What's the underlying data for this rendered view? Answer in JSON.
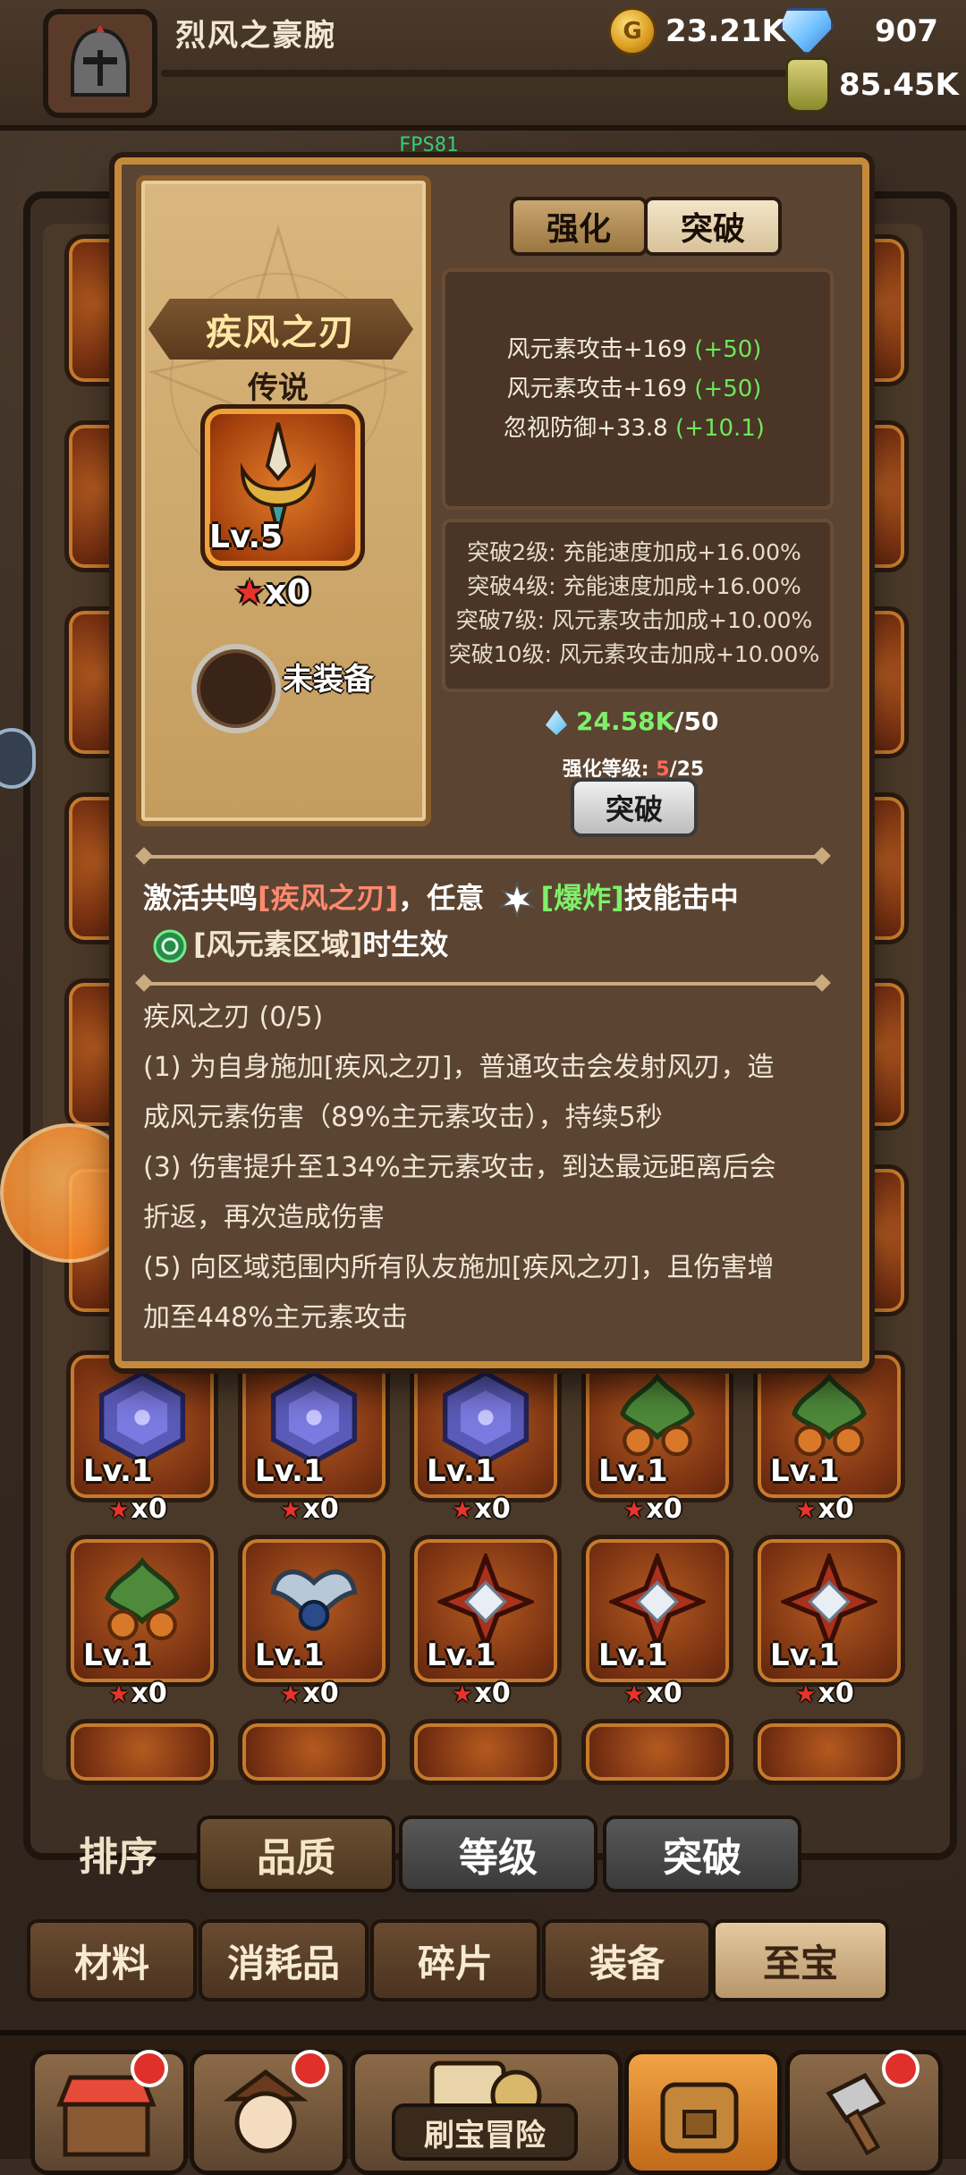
{
  "topbar": {
    "player_name": "烈风之豪腕",
    "gold": "23.21K",
    "gems": "907",
    "potion": "85.45K"
  },
  "fps": "FPS81",
  "modal": {
    "item_name": "疾风之刃",
    "rarity": "传说",
    "item_level": "Lv.5",
    "item_count": "x0",
    "equip_status": "未装备",
    "tabs": [
      "强化",
      "突破"
    ],
    "stats": [
      {
        "text": "风元素攻击+169",
        "bonus": "(+50)"
      },
      {
        "text": "风元素攻击+169",
        "bonus": "(+50)"
      },
      {
        "text": "忽视防御+33.8",
        "bonus": "(+10.1)"
      }
    ],
    "breakthroughs": [
      "突破2级: 充能速度加成+16.00%",
      "突破4级: 充能速度加成+16.00%",
      "突破7级: 风元素攻击加成+10.00%",
      "突破10级: 风元素攻击加成+10.00%"
    ],
    "resource_have": "24.58K",
    "resource_need": "/50",
    "enhance_level_label": "强化等级:",
    "enhance_level_current": "5",
    "enhance_level_max": "/25",
    "break_button": "突破",
    "resonance_prefix": "激活共鸣",
    "resonance_set": "[疾风之刃]",
    "resonance_mid": "，任意",
    "resonance_skill": "[爆炸]",
    "resonance_mid2": "技能击中",
    "resonance_zone": "[风元素区域]",
    "resonance_suffix": "时生效",
    "desc_title": "疾风之刃 (0/5)",
    "desc_1a": " (1) 为自身施加[疾风之刃]，普通攻击会发射风刃，造",
    "desc_1b": "成风元素伤害（89%主元素攻击），持续5秒",
    "desc_3a": " (3) 伤害提升至134%主元素攻击，到达最远距离后会",
    "desc_3b": "折返，再次造成伤害",
    "desc_5a": " (5) 向区域范围内所有队友施加[疾风之刃]，且伤害增",
    "desc_5b": "加至448%主元素攻击"
  },
  "grid": {
    "row1": [
      {
        "lv": "Lv.1",
        "count": "x0",
        "icon": "purple-hex-gem"
      },
      {
        "lv": "Lv.1",
        "count": "x0",
        "icon": "purple-hex-gem"
      },
      {
        "lv": "Lv.1",
        "count": "x0",
        "icon": "purple-hex-gem"
      },
      {
        "lv": "Lv.1",
        "count": "x0",
        "icon": "green-leaf-gem"
      },
      {
        "lv": "Lv.1",
        "count": "x0",
        "icon": "green-leaf-gem"
      }
    ],
    "row2": [
      {
        "lv": "Lv.1",
        "count": "x0",
        "icon": "green-leaf-gem"
      },
      {
        "lv": "Lv.1",
        "count": "x0",
        "icon": "silver-wing-gem"
      },
      {
        "lv": "Lv.1",
        "count": "x0",
        "icon": "red-star-gem"
      },
      {
        "lv": "Lv.1",
        "count": "x0",
        "icon": "red-star-gem"
      },
      {
        "lv": "Lv.1",
        "count": "x0",
        "icon": "red-star-gem"
      }
    ]
  },
  "sort": {
    "label": "排序",
    "options": [
      "品质",
      "等级",
      "突破"
    ]
  },
  "categories": [
    "材料",
    "消耗品",
    "碎片",
    "装备",
    "至宝"
  ],
  "bottom_nav": {
    "adventure_label": "刷宝冒险"
  },
  "colors": {
    "accent_gold": "#c48a3a",
    "bonus_green": "#6ee85a",
    "highlight_red": "#ff8a70"
  }
}
